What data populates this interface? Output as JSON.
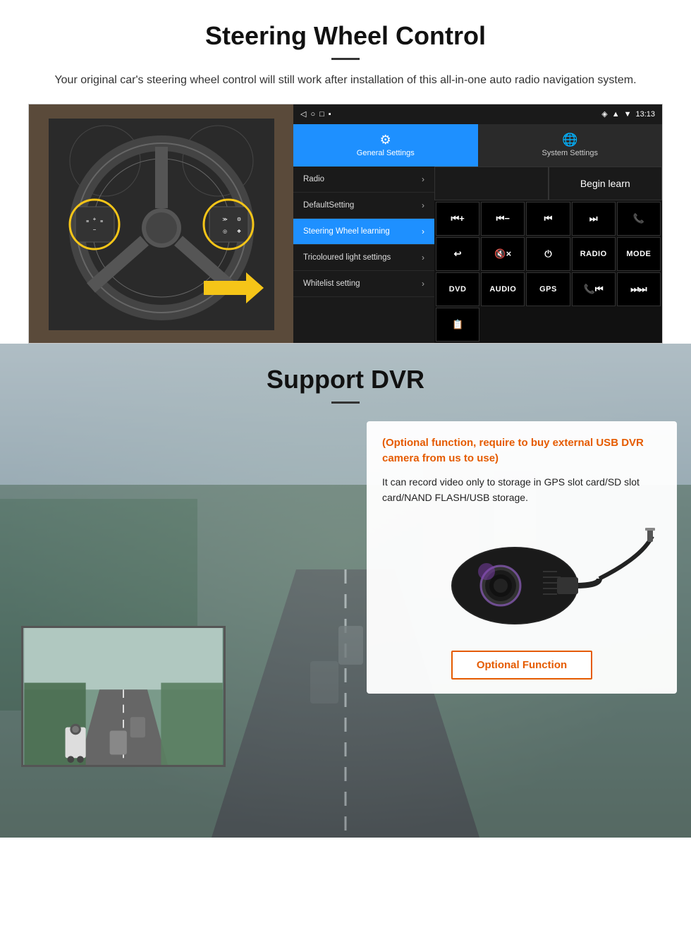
{
  "section1": {
    "title": "Steering Wheel Control",
    "description": "Your original car's steering wheel control will still work after installation of this all-in-one auto radio navigation system.",
    "statusbar": {
      "time": "13:13",
      "signal": "▲",
      "wifi": "▼",
      "battery": "■"
    },
    "tabs": {
      "general": "General Settings",
      "system": "System Settings"
    },
    "menu": [
      {
        "label": "Radio",
        "active": false
      },
      {
        "label": "DefaultSetting",
        "active": false
      },
      {
        "label": "Steering Wheel learning",
        "active": true
      },
      {
        "label": "Tricoloured light settings",
        "active": false
      },
      {
        "label": "Whitelist setting",
        "active": false
      }
    ],
    "begin_learn": "Begin learn",
    "buttons": [
      "⏮+",
      "⏮-",
      "⏮",
      "⏭",
      "📞",
      "↩",
      "🔇×",
      "⏻",
      "RADIO",
      "MODE",
      "DVD",
      "AUDIO",
      "GPS",
      "📞⏮",
      "⏭⏭"
    ]
  },
  "section2": {
    "title": "Support DVR",
    "card": {
      "optional_text": "(Optional function, require to buy external USB DVR camera from us to use)",
      "description": "It can record video only to storage in GPS slot card/SD slot card/NAND FLASH/USB storage.",
      "button_label": "Optional Function"
    }
  }
}
